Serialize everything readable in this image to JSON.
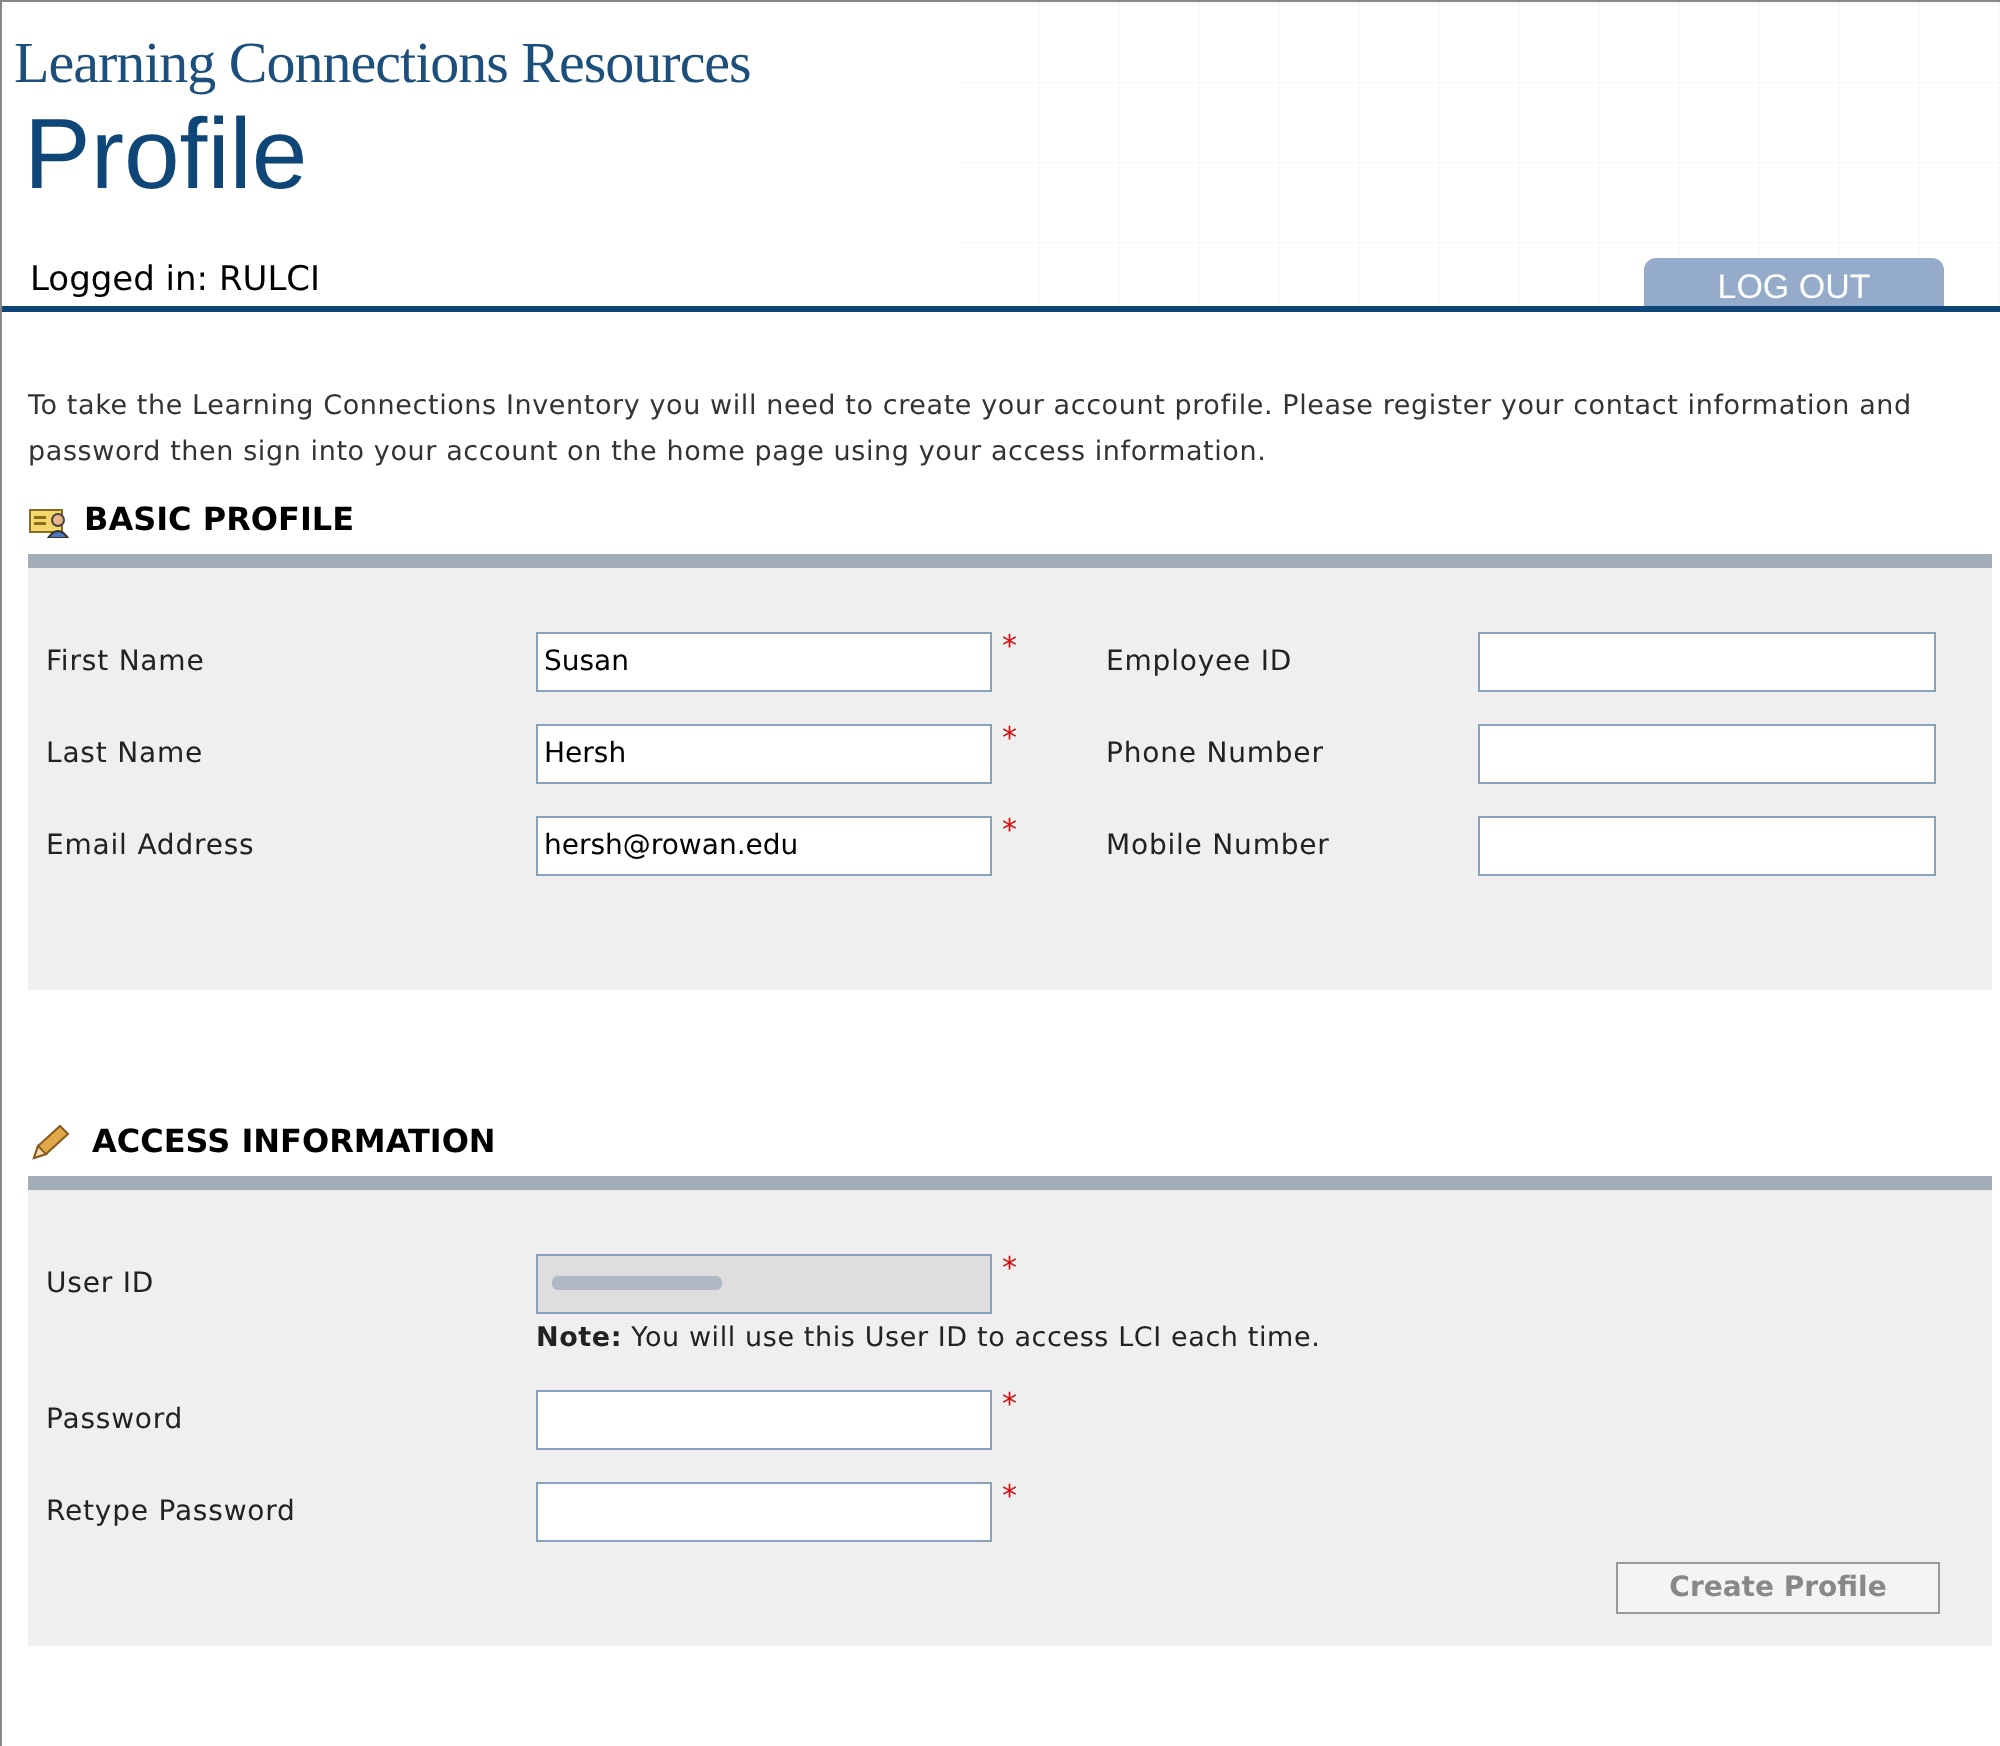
{
  "header": {
    "site_title": "Learning Connections Resources",
    "page_title": "Profile",
    "logged_in": "Logged in: RULCI",
    "logout_button": "LOG OUT"
  },
  "intro": "To take the Learning Connections Inventory you will need to create your account profile. Please register your contact information and password then sign into your account on the home page using your access information.",
  "basic_profile": {
    "heading": "BASIC PROFILE",
    "left_fields": [
      {
        "label": "First Name",
        "value": "Susan",
        "required_mark": "*"
      },
      {
        "label": "Last Name",
        "value": "Hersh",
        "required_mark": "*"
      },
      {
        "label": "Email Address",
        "value": "hersh@rowan.edu",
        "required_mark": "*"
      }
    ],
    "right_fields": [
      {
        "label": "Employee ID"
      },
      {
        "label": "Phone Number"
      },
      {
        "label": "Mobile Number"
      }
    ]
  },
  "access_information": {
    "heading": "ACCESS INFORMATION",
    "fields": [
      {
        "label": "User ID",
        "disabled": true,
        "required_mark": "*",
        "note": "**Note:** You will use this User ID to access LCI each time."
      },
      {
        "label": "Password",
        "disabled": false,
        "required_mark": "*"
      },
      {
        "label": "Retype Password",
        "disabled": false,
        "required_mark": "*"
      }
    ],
    "submit_button": {
      "label": "Create Profile",
      "disabled": true
    }
  }
}
